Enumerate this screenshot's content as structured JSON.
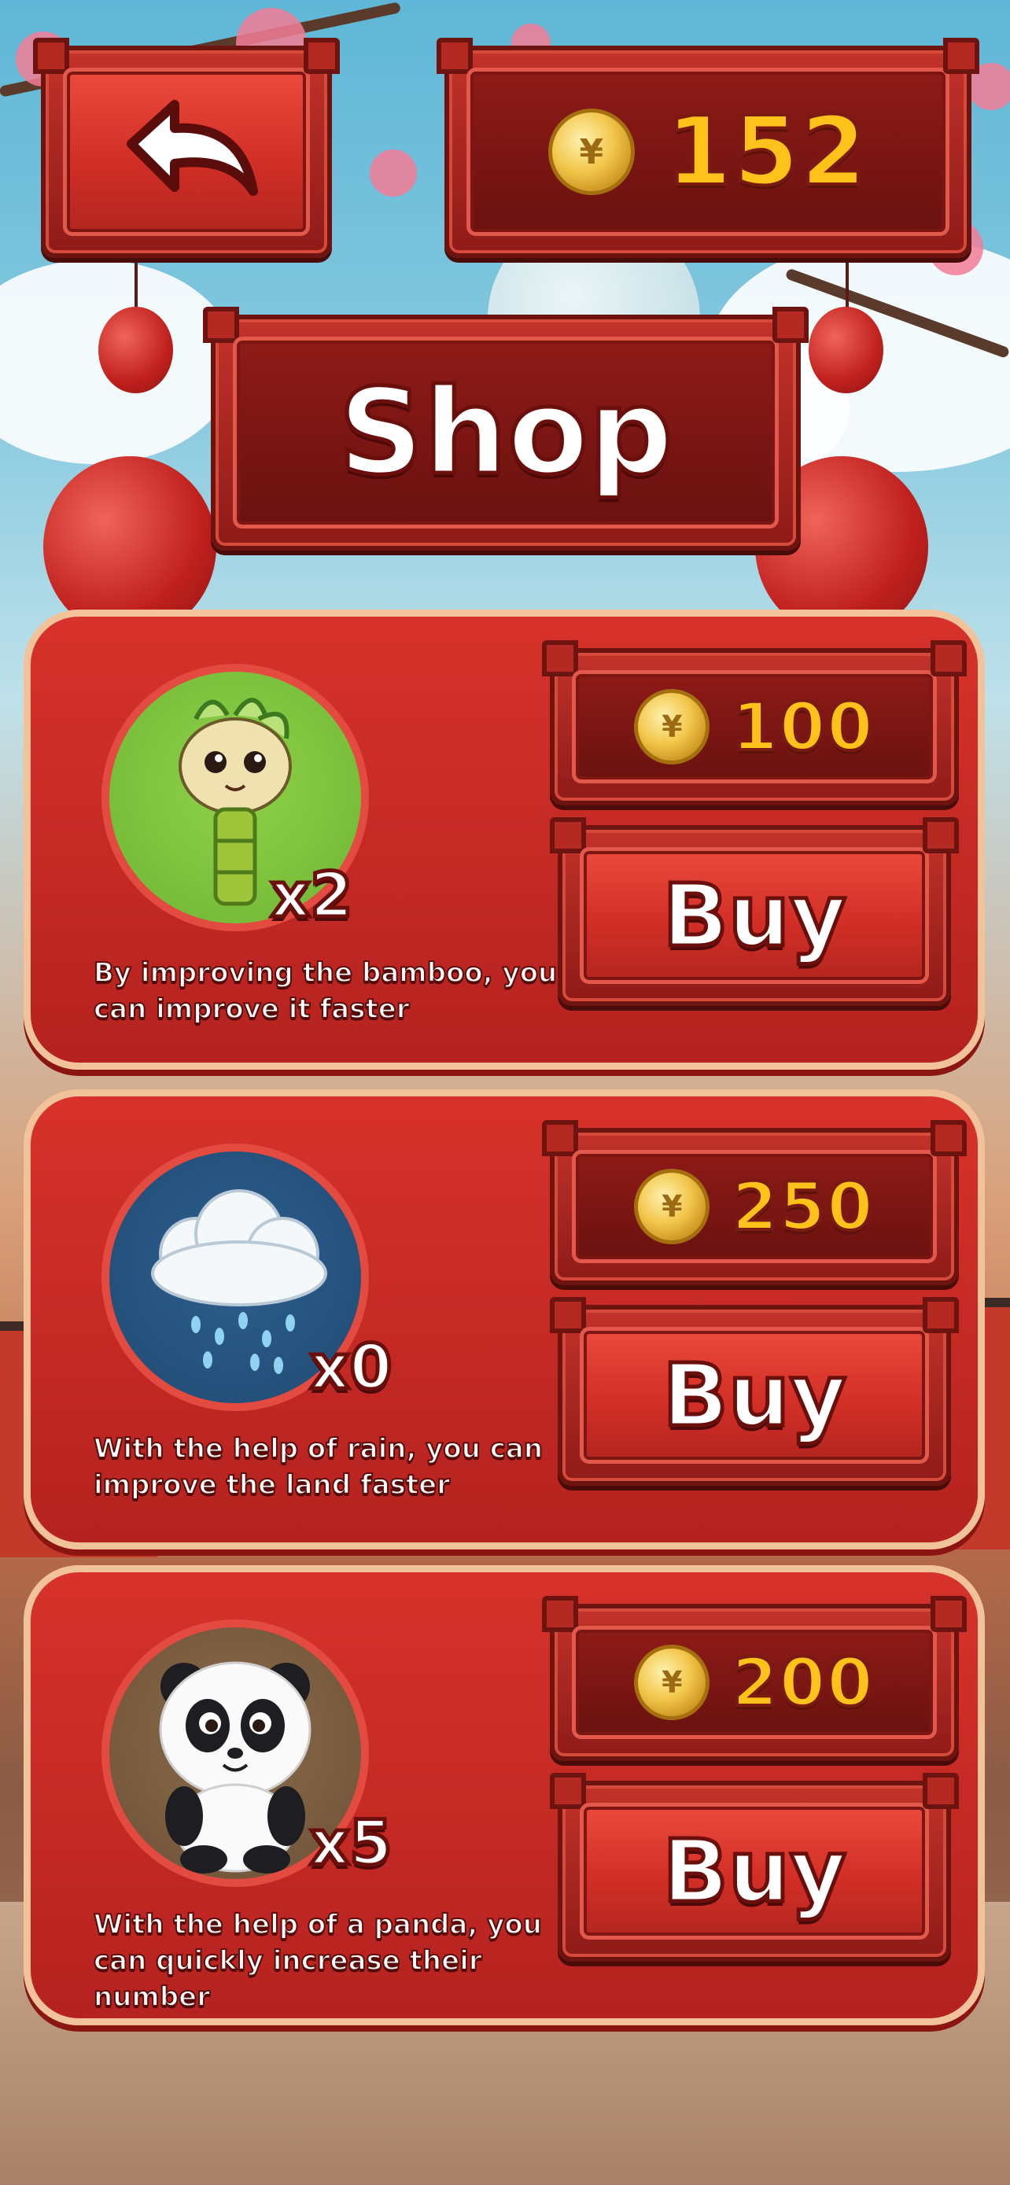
{
  "header": {
    "back_icon": "back-arrow-icon",
    "coin_icon": "gold-coin-icon",
    "balance": "152",
    "title": "Shop"
  },
  "items": [
    {
      "icon": "bamboo-character-icon",
      "count": "x2",
      "description": "By improving the bamboo, you can improve it faster",
      "price": "100",
      "buy_label": "Buy"
    },
    {
      "icon": "rain-cloud-icon",
      "count": "x0",
      "description": "With the help of rain, you can improve the land faster",
      "price": "250",
      "buy_label": "Buy"
    },
    {
      "icon": "panda-icon",
      "count": "x5",
      "description": "With the help of a panda, you can quickly increase their number",
      "price": "200",
      "buy_label": "Buy"
    }
  ],
  "colors": {
    "accent_red": "#c8291f",
    "gold": "#ffc21a",
    "card_border": "#f2c39a"
  }
}
